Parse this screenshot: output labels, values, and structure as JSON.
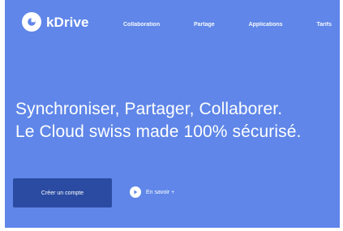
{
  "brand": {
    "name": "kDrive",
    "icon": "kdrive-logo-icon"
  },
  "nav": {
    "items": [
      "Collaboration",
      "Partage",
      "Applications",
      "Tarifs"
    ]
  },
  "hero": {
    "headline_line1": "Synchroniser, Partager, Collaborer.",
    "headline_line2": "Le Cloud swiss made 100% sécurisé."
  },
  "actions": {
    "primary_label": "Créer un compte",
    "secondary_label": "En savoir +",
    "secondary_icon": "play-icon"
  },
  "colors": {
    "hero_background": "#5f86e8",
    "primary_button": "#2a4ba1",
    "text": "#ffffff"
  }
}
